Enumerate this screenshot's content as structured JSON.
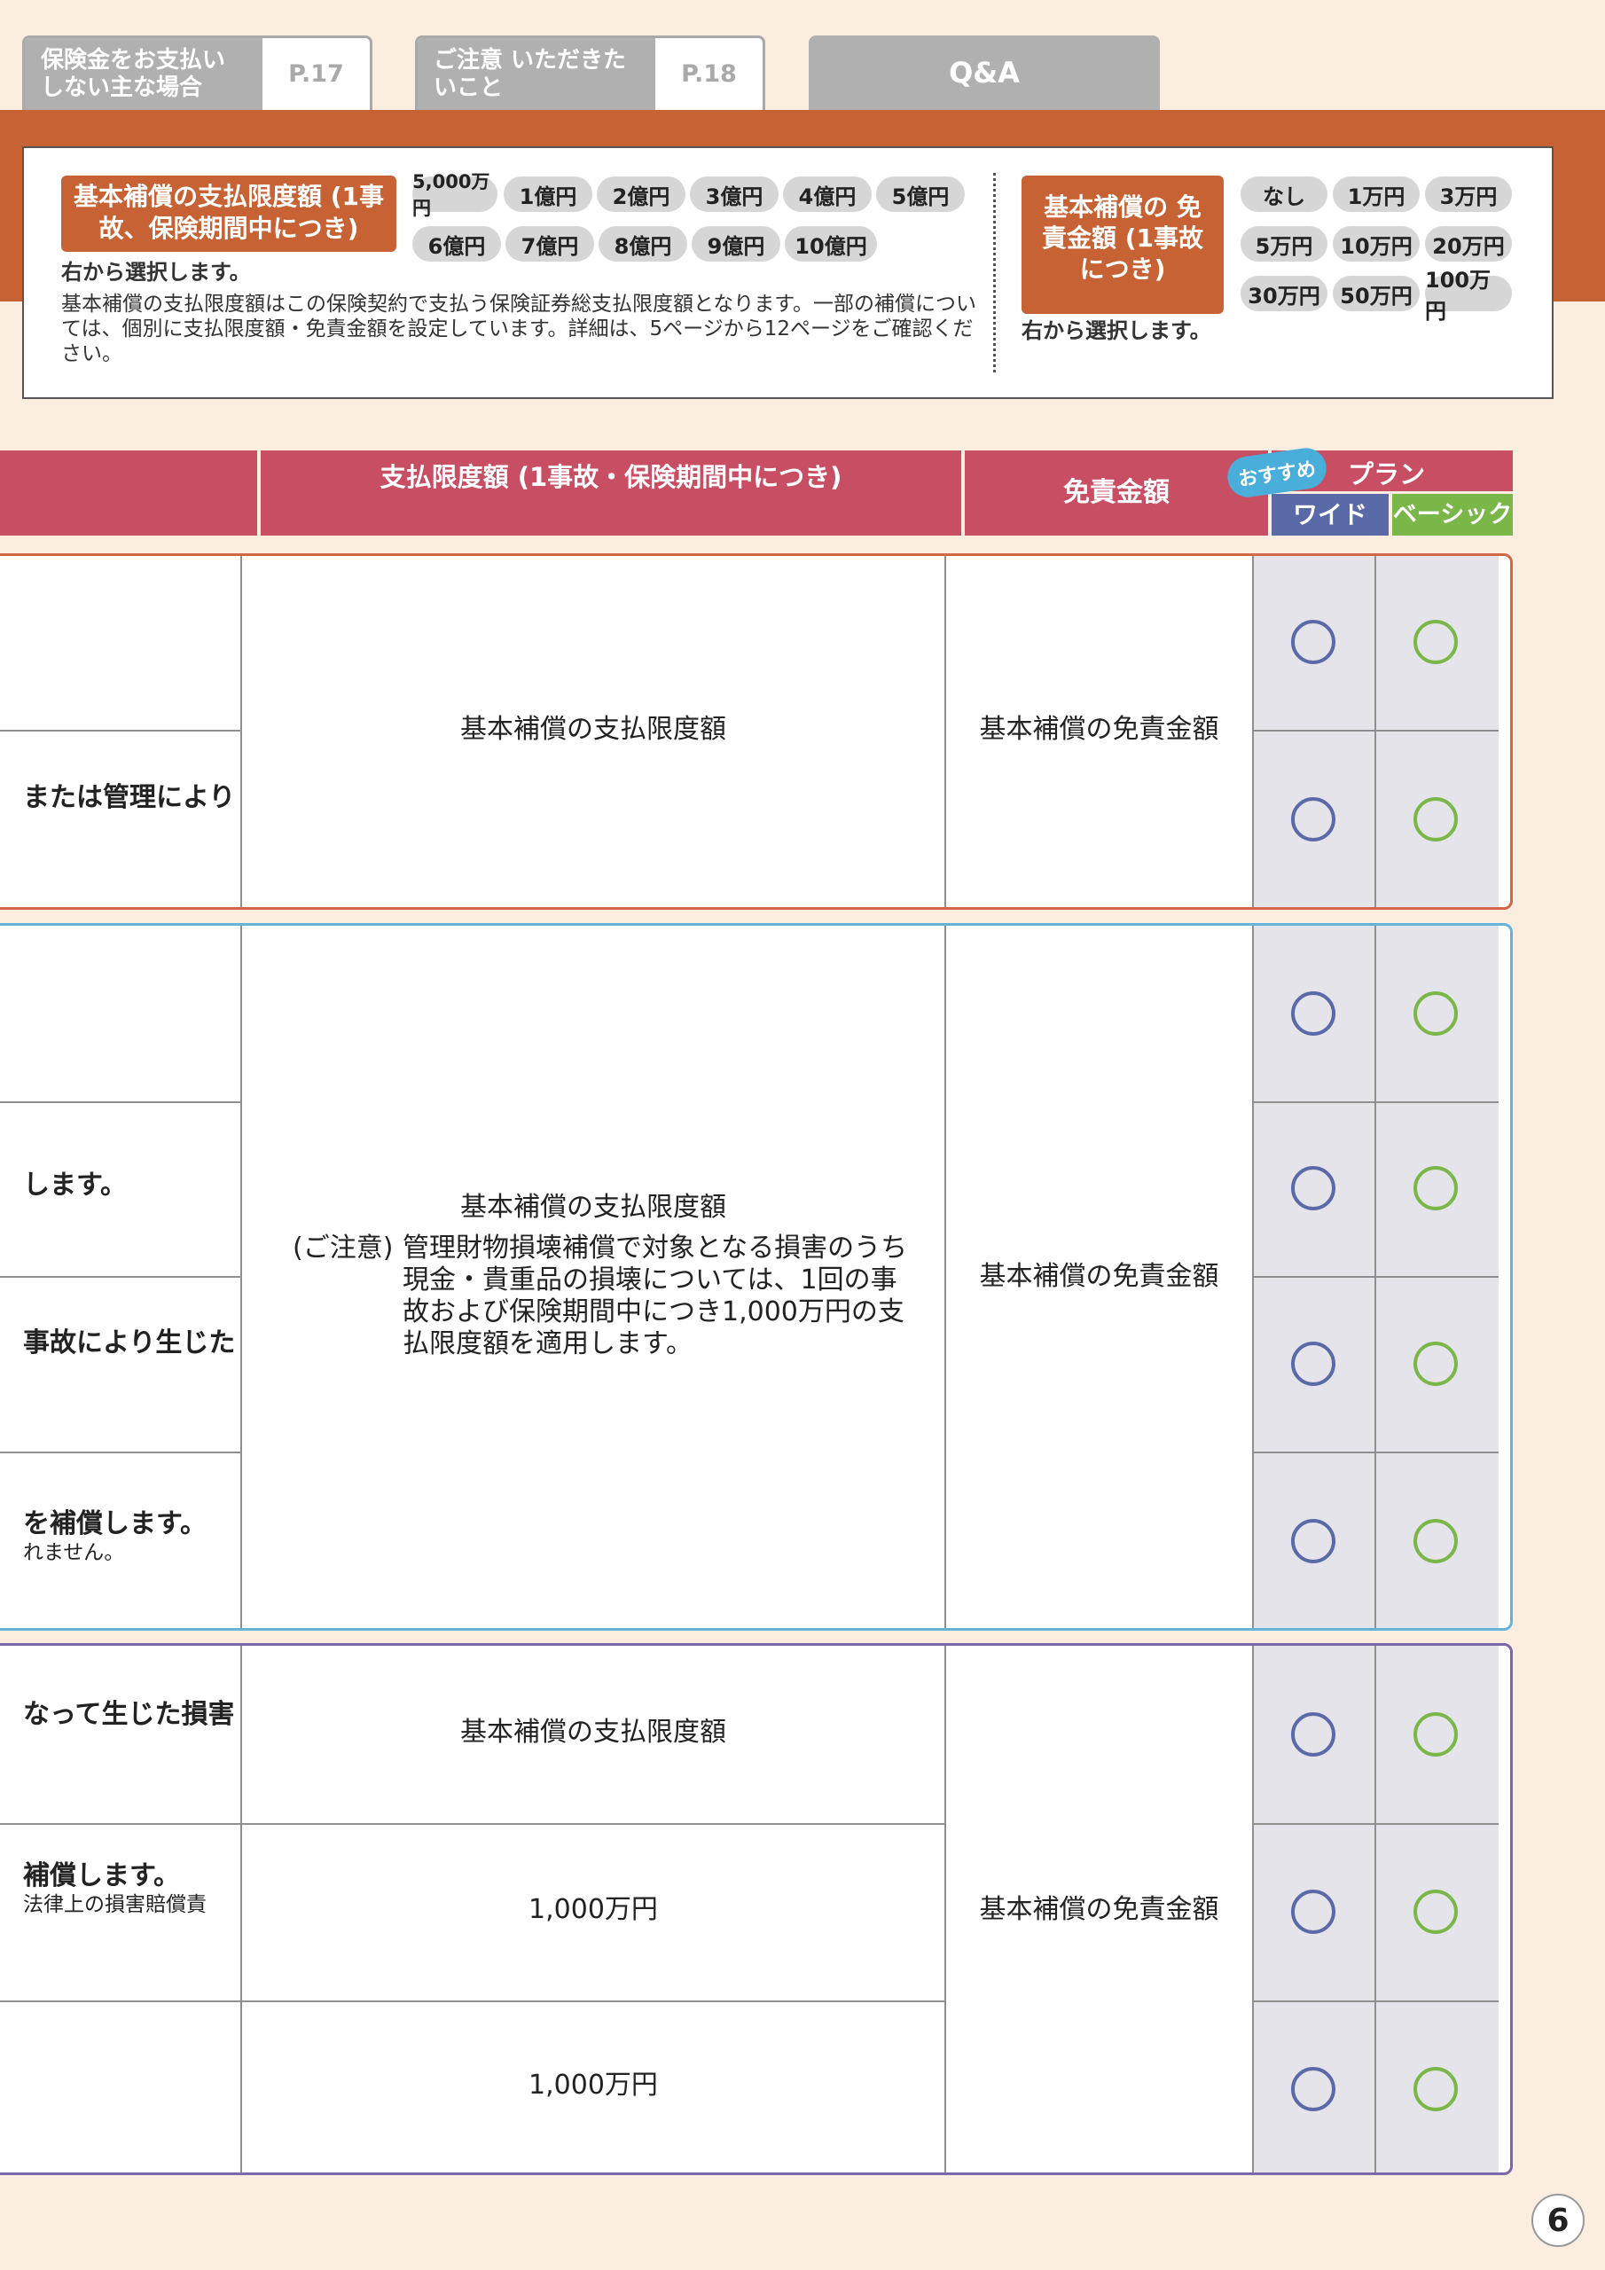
{
  "tabs": [
    {
      "label": "保険金をお支払い しない主な場合",
      "page": "P.17"
    },
    {
      "label": "ご注意 いただきたいこと",
      "page": "P.18"
    }
  ],
  "qa_tab": "Q&A",
  "limit_box": {
    "badge": "基本補償の支払限度額 (1事故、保険期間中につき)",
    "select_note": "右から選択します。",
    "options": [
      "5,000万円",
      "1億円",
      "2億円",
      "3億円",
      "4億円",
      "5億円",
      "6億円",
      "7億円",
      "8億円",
      "9億円",
      "10億円"
    ],
    "description": "基本補償の支払限度額はこの保険契約で支払う保険証券総支払限度額となります。一部の補償については、個別に支払限度額・免責金額を設定しています。詳細は、5ページから12ページをご確認ください。"
  },
  "deductible_box": {
    "badge": "基本補償の 免責金額 (1事故につき)",
    "select_note": "右から選択します。",
    "options": [
      "なし",
      "1万円",
      "3万円",
      "5万円",
      "10万円",
      "20万円",
      "30万円",
      "50万円",
      "100万円"
    ]
  },
  "table_header": {
    "limit": "支払限度額 (1事故・保険期間中につき)",
    "deductible": "免責金額",
    "recommended": "おすすめ",
    "plan": "プラン",
    "wide": "ワイド",
    "basic": "ベーシック"
  },
  "groups": [
    {
      "rows": [
        "",
        "または管理により"
      ],
      "limit_text": "基本補償の支払限度額",
      "deductible_text": "基本補償の免責金額"
    },
    {
      "rows": [
        "",
        "します。",
        "事故により生じた",
        "を補償します。"
      ],
      "row_sub": "れません。",
      "limit_title": "基本補償の支払限度額",
      "caution_label": "(ご注意)",
      "caution_text": "管理財物損壊補償で対象となる損害のうち現金・貴重品の損壊については、1回の事故および保険期間中につき1,000万円の支払限度額を適用します。",
      "deductible_text": "基本補償の免責金額"
    },
    {
      "rows": [
        "なって生じた損害",
        "補償します。",
        ""
      ],
      "row_sub": "法律上の損害賠償責",
      "limits": [
        "基本補償の支払限度額",
        "1,000万円",
        "1,000万円"
      ],
      "deductible_text": "基本補償の免責金額"
    }
  ],
  "page_number": "6",
  "colors": {
    "orange": "#c66233",
    "header_red": "#c84f63",
    "wide_blue": "#5a6aa8",
    "basic_green": "#7ab648",
    "recommend_cyan": "#49aed9"
  }
}
